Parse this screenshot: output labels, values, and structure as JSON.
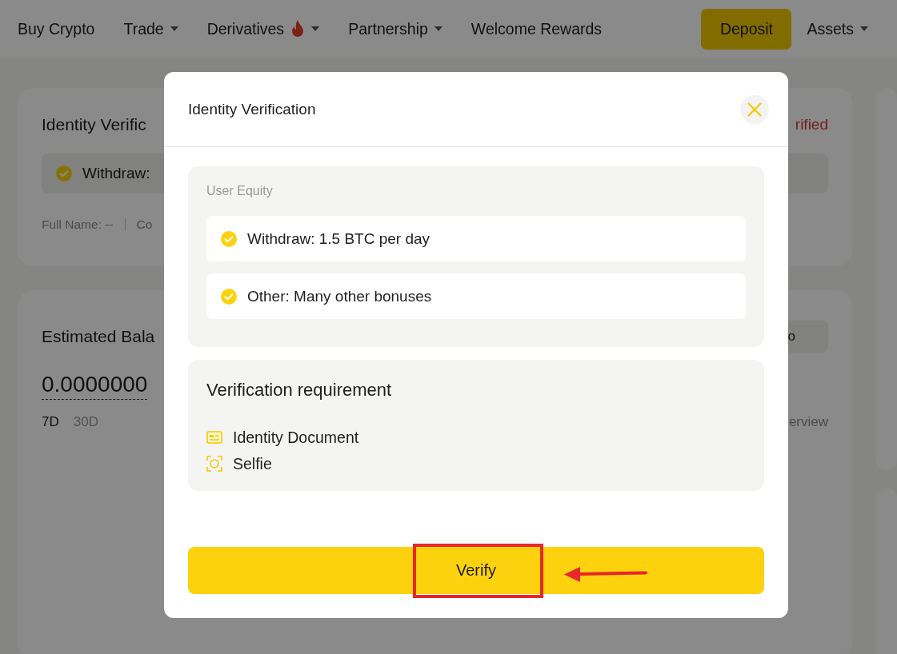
{
  "nav": {
    "items": [
      {
        "label": "Buy Crypto",
        "dropdown": false,
        "hot": false
      },
      {
        "label": "Trade",
        "dropdown": true,
        "hot": false
      },
      {
        "label": "Derivatives",
        "dropdown": true,
        "hot": true
      },
      {
        "label": "Partnership",
        "dropdown": true,
        "hot": false
      },
      {
        "label": "Welcome Rewards",
        "dropdown": false,
        "hot": false
      }
    ],
    "deposit_button": "Deposit",
    "assets_menu": {
      "label": "Assets",
      "dropdown": true
    }
  },
  "background": {
    "identity_card": {
      "title": "Identity Verific",
      "status": "rified",
      "benefit": "Withdraw:",
      "full_name": "Full Name: --",
      "field_2": "Co"
    },
    "balance_card": {
      "title": "Estimated Bala",
      "amount": "0.0000000",
      "button_fragment": "o",
      "link_fragment": "erview",
      "periods": [
        {
          "label": "7D",
          "selected": true
        },
        {
          "label": "30D",
          "selected": false
        }
      ]
    }
  },
  "modal": {
    "title": "Identity Verification",
    "equity": {
      "label": "User Equity",
      "items": [
        "Withdraw: 1.5 BTC per day",
        "Other: Many other bonuses"
      ]
    },
    "requirements": {
      "title": "Verification requirement",
      "items": [
        {
          "kind": "document",
          "label": "Identity Document"
        },
        {
          "kind": "selfie",
          "label": "Selfie"
        }
      ]
    },
    "verify_button": "Verify"
  }
}
